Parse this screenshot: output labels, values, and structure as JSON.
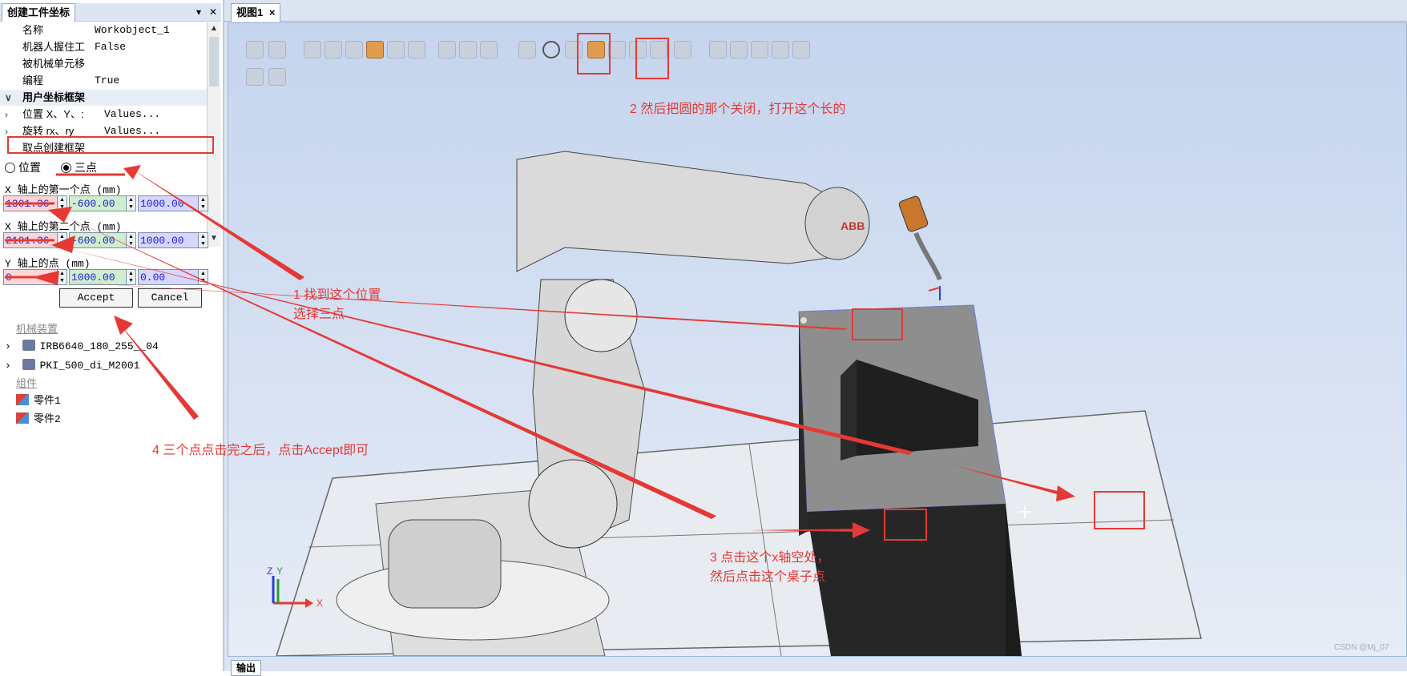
{
  "left_panel": {
    "title": "创建工件坐标",
    "pin_glyph": "▾",
    "close_glyph": "✕",
    "props": [
      {
        "key": "名称",
        "value": "Workobject_1"
      },
      {
        "key": "机器人握住工",
        "value": "False"
      },
      {
        "key": "被机械单元移",
        "value": ""
      },
      {
        "key": "编程",
        "value": "True"
      }
    ],
    "section_user_frame": "用户坐标框架",
    "section_children": [
      {
        "key": "位置 X、Y、:",
        "value": "Values..."
      },
      {
        "key": "旋转 rx、ry",
        "value": "Values..."
      }
    ],
    "pick_points": "取点创建框架",
    "radio_position": "位置",
    "radio_three_points": "三点",
    "selected_radio": "三点",
    "x1_label": "X 轴上的第一个点 (mm)",
    "x1": [
      "1301.36",
      "-600.00",
      "1000.00"
    ],
    "x2_label": "X 轴上的第二个点 (mm)",
    "x2": [
      "2101.36",
      "-600.00",
      "1000.00"
    ],
    "y_label": "Y 轴上的点 (mm)",
    "y": [
      "0",
      "1000.00",
      "0.00"
    ],
    "accept": "Accept",
    "cancel": "Cancel",
    "tree": {
      "cat_mechanism": "机械装置",
      "robot": "IRB6640_180_255__04",
      "tool": "PKI_500_di_M2001",
      "cat_component": "组件",
      "part1": "零件1",
      "part2": "零件2"
    }
  },
  "view": {
    "tab": "视图1",
    "tab_close": "×",
    "bottom_tab": "输出",
    "robot_brand": "ABB",
    "axis_labels": {
      "x": "X",
      "y": "Y",
      "z": "Z"
    },
    "watermark": "CSDN @Mj_07"
  },
  "annotations": {
    "a1_line1": "1 找到这个位置",
    "a1_line2": "选择三点",
    "a2": "2 然后把圆的那个关闭，打开这个长的",
    "a3_line1": "3 点击这个x轴空处，",
    "a3_line2": "然后点击这个桌子点",
    "a4": "4 三个点点击完之后，点击Accept即可"
  },
  "colors": {
    "annotation": "#e53935",
    "highlight_icon": "#e09b4d",
    "axis_x": "#e53935",
    "axis_y": "#2e9d2e",
    "axis_z": "#2a3fd6"
  },
  "icons": [
    "snap-object-icon",
    "snap-grid-icon",
    "snap-center-icon",
    "snap-edge-icon",
    "snap-midpoint-icon",
    "snap-end-icon",
    "snap-circle-icon",
    "snap-line-icon",
    "measure-point-icon",
    "measure-angle-icon",
    "play-icon",
    "stop-icon"
  ]
}
